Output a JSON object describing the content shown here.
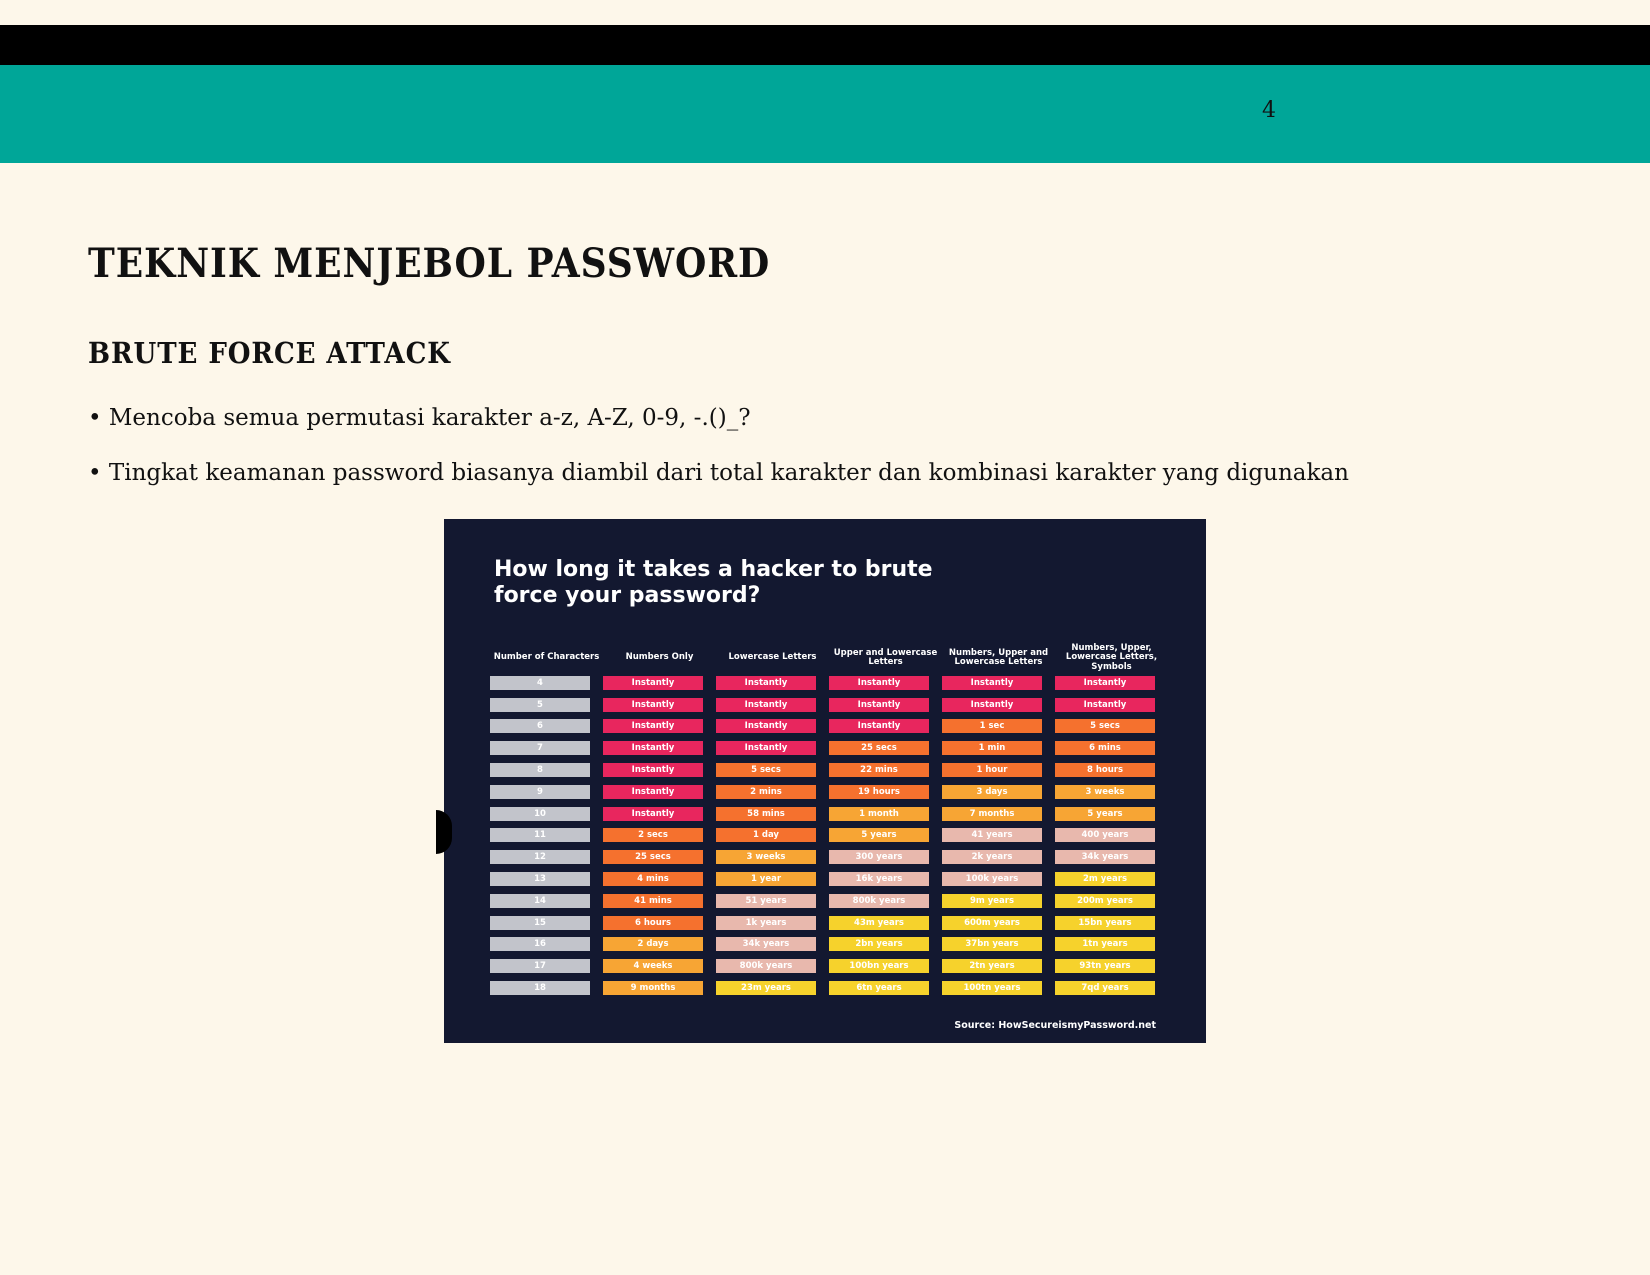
{
  "page_number": "4",
  "title": "TEKNIK MENJEBOL PASSWORD",
  "subtitle": "BRUTE FORCE ATTACK",
  "bullets": [
    "• Mencoba semua permutasi karakter a-z, A-Z, 0-9, -.()_?",
    "• Tingkat keamanan password biasanya diambil dari total karakter dan kombinasi karakter yang digunakan"
  ],
  "infographic": {
    "title_line1": "How long it takes a hacker to brute",
    "title_line2": "force your password?",
    "headers": [
      "Number of Characters",
      "Numbers Only",
      "Lowercase Letters",
      "Upper and Lowercase Letters",
      "Numbers, Upper and Lowercase Letters",
      "Numbers, Upper, Lowercase Letters, Symbols"
    ],
    "rows": [
      [
        "4",
        "Instantly",
        "Instantly",
        "Instantly",
        "Instantly",
        "Instantly"
      ],
      [
        "5",
        "Instantly",
        "Instantly",
        "Instantly",
        "Instantly",
        "Instantly"
      ],
      [
        "6",
        "Instantly",
        "Instantly",
        "Instantly",
        "1 sec",
        "5 secs"
      ],
      [
        "7",
        "Instantly",
        "Instantly",
        "25 secs",
        "1 min",
        "6 mins"
      ],
      [
        "8",
        "Instantly",
        "5 secs",
        "22 mins",
        "1 hour",
        "8 hours"
      ],
      [
        "9",
        "Instantly",
        "2 mins",
        "19 hours",
        "3 days",
        "3 weeks"
      ],
      [
        "10",
        "Instantly",
        "58 mins",
        "1 month",
        "7 months",
        "5 years"
      ],
      [
        "11",
        "2 secs",
        "1 day",
        "5 years",
        "41 years",
        "400 years"
      ],
      [
        "12",
        "25 secs",
        "3 weeks",
        "300 years",
        "2k years",
        "34k years"
      ],
      [
        "13",
        "4 mins",
        "1 year",
        "16k years",
        "100k years",
        "2m years"
      ],
      [
        "14",
        "41 mins",
        "51 years",
        "800k years",
        "9m years",
        "200m years"
      ],
      [
        "15",
        "6 hours",
        "1k years",
        "43m years",
        "600m years",
        "15bn years"
      ],
      [
        "16",
        "2 days",
        "34k years",
        "2bn years",
        "37bn years",
        "1tn years"
      ],
      [
        "17",
        "4 weeks",
        "800k years",
        "100bn years",
        "2tn years",
        "93tn years"
      ],
      [
        "18",
        "9 months",
        "23m years",
        "6tn years",
        "100tn years",
        "7qd years"
      ]
    ],
    "source": "Source: HowSecureismyPassword.net",
    "colors": {
      "instantly": "#e8265e",
      "short": "#f5712e",
      "medium": "#f7a534",
      "long": "#e8b8ad",
      "very_long": "#f6d22c",
      "char_count": "#c2c4cb"
    }
  }
}
